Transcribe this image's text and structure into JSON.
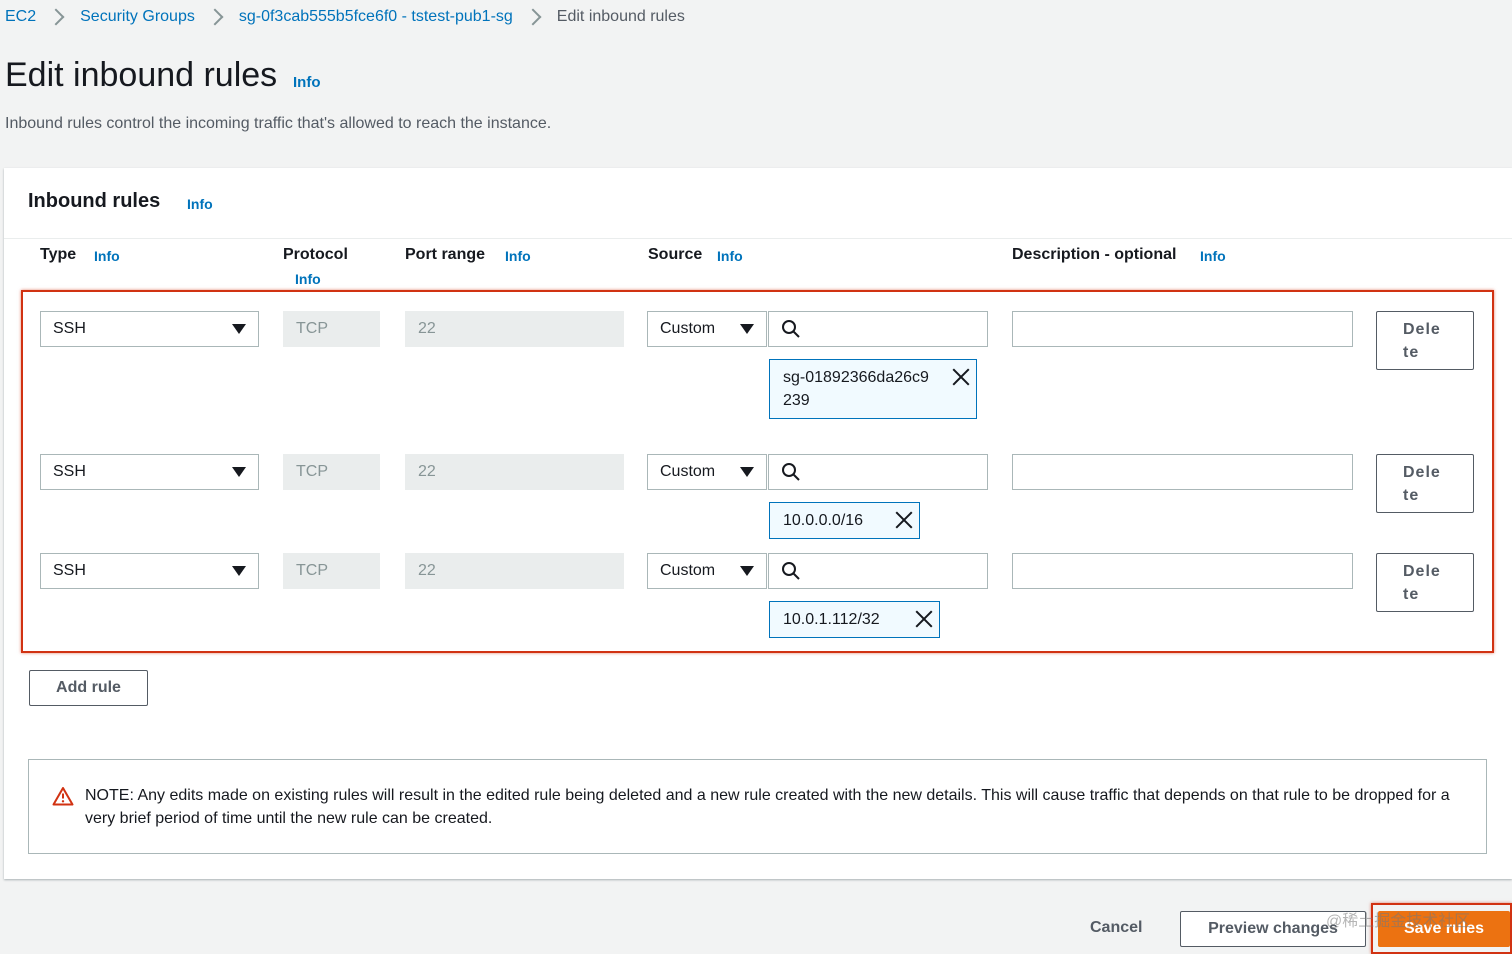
{
  "breadcrumb": {
    "items": [
      "EC2",
      "Security Groups",
      "sg-0f3cab555b5fce6f0 - tstest-pub1-sg"
    ],
    "current": "Edit inbound rules"
  },
  "page": {
    "title": "Edit inbound rules",
    "info": "Info",
    "subtitle": "Inbound rules control the incoming traffic that's allowed to reach the instance."
  },
  "panel": {
    "title": "Inbound rules",
    "info": "Info",
    "columns": {
      "type": "Type",
      "protocol": "Protocol",
      "port_range": "Port range",
      "source": "Source",
      "description": "Description - optional",
      "info": "Info"
    }
  },
  "rules": [
    {
      "type": "SSH",
      "protocol": "TCP",
      "port": "22",
      "source_type": "Custom",
      "token": "sg-01892366da26c9239",
      "delete": "Delete"
    },
    {
      "type": "SSH",
      "protocol": "TCP",
      "port": "22",
      "source_type": "Custom",
      "token": "10.0.0.0/16",
      "delete": "Delete"
    },
    {
      "type": "SSH",
      "protocol": "TCP",
      "port": "22",
      "source_type": "Custom",
      "token": "10.0.1.112/32",
      "delete": "Delete"
    }
  ],
  "add_rule_label": "Add rule",
  "note": "NOTE: Any edits made on existing rules will result in the edited rule being deleted and a new rule created with the new details. This will cause traffic that depends on that rule to be dropped for a very brief period of time until the new rule can be created.",
  "footer": {
    "cancel": "Cancel",
    "preview": "Preview changes",
    "save": "Save rules"
  },
  "watermark": "@稀土掘金技术社区",
  "colors": {
    "link": "#0073bb",
    "primary_button": "#ec7211",
    "highlight_border": "#d13212",
    "token_bg": "#f1faff"
  }
}
